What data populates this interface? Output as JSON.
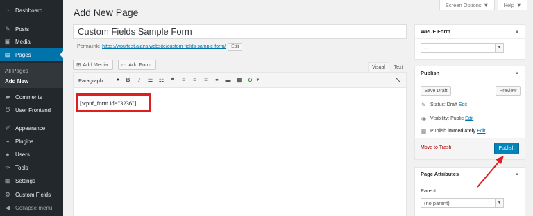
{
  "sidebar": {
    "items": [
      {
        "label": "Dashboard",
        "icon": "dashboard-icon"
      },
      {
        "label": "Posts",
        "icon": "pin-icon"
      },
      {
        "label": "Media",
        "icon": "media-icon"
      },
      {
        "label": "Pages",
        "icon": "pages-icon"
      },
      {
        "label": "Comments",
        "icon": "comment-icon"
      },
      {
        "label": "User Frontend",
        "icon": "frontend-icon"
      },
      {
        "label": "Appearance",
        "icon": "brush-icon"
      },
      {
        "label": "Plugins",
        "icon": "plugin-icon"
      },
      {
        "label": "Users",
        "icon": "user-icon"
      },
      {
        "label": "Tools",
        "icon": "wrench-icon"
      },
      {
        "label": "Settings",
        "icon": "sliders-icon"
      },
      {
        "label": "Custom Fields",
        "icon": "gear-icon"
      },
      {
        "label": "Collapse menu",
        "icon": "collapse-icon"
      }
    ],
    "submenu": [
      "All Pages",
      "Add New"
    ]
  },
  "top": {
    "screen_options": "Screen Options",
    "help": "Help"
  },
  "page_title": "Add New Page",
  "post_title": "Custom Fields Sample Form",
  "permalink": {
    "label": "Permalink:",
    "url": "https://wpuftest.ajaira.website/custom-fields-sample-form/",
    "edit": "Edit"
  },
  "media": {
    "add_media": "Add Media",
    "add_form": "Add Form"
  },
  "tabs": {
    "visual": "Visual",
    "text": "Text"
  },
  "toolbar": {
    "format": "Paragraph"
  },
  "content": "[wpuf_form id=\"3236\"]",
  "wpuf_box": {
    "title": "WPUF Form",
    "select_value": "--"
  },
  "publish_box": {
    "title": "Publish",
    "save_draft": "Save Draft",
    "preview": "Preview",
    "status_label": "Status:",
    "status_value": "Draft",
    "visibility_label": "Visibility:",
    "visibility_value": "Public",
    "publish_label": "Publish",
    "publish_value": "immediately",
    "edit": "Edit",
    "trash": "Move to Trash",
    "publish_button": "Publish"
  },
  "attributes_box": {
    "title": "Page Attributes",
    "parent_label": "Parent",
    "parent_value": "(no parent)"
  },
  "colors": {
    "accent": "#0073aa",
    "highlight": "#e01e1e",
    "sidebar": "#23282d",
    "publish": "#0085ba"
  }
}
